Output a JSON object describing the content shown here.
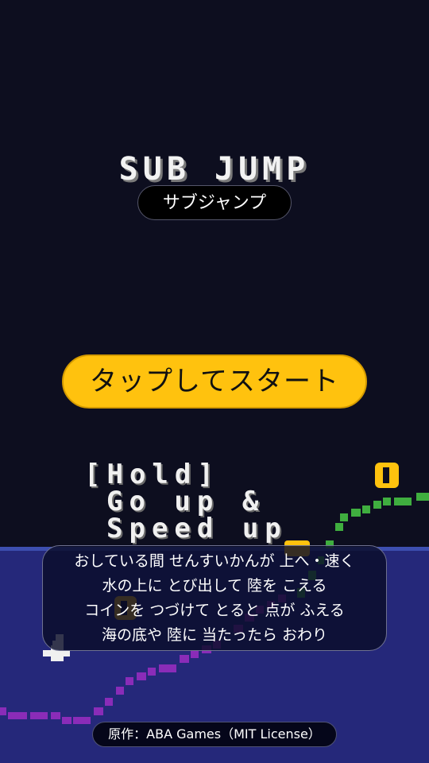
{
  "title": {
    "pixel_text": "SUB JUMP",
    "japanese": "サブジャンプ"
  },
  "start_button": {
    "label": "タップしてスタート"
  },
  "help_pixel": {
    "lines": [
      "[Hold]",
      "Go up &",
      "Speed up"
    ]
  },
  "instructions": {
    "lines": [
      "おしている間 せんすいかんが 上へ・速く",
      "水の上に とび出して 陸を こえる",
      "コインを つづけて とると 点が ふえる",
      "海の底や 陸に 当たったら おわり"
    ]
  },
  "credit": "原作：ABA Games（MIT License）",
  "colors": {
    "background": "#0d0e1f",
    "sea": "#25287a",
    "sea_surface": "#3d4fb0",
    "seabed": "#8a2cb8",
    "land": "#3fae3f",
    "coin": "#ffc20e",
    "submarine": "#f0f0f0",
    "button": "#ffc20e"
  }
}
